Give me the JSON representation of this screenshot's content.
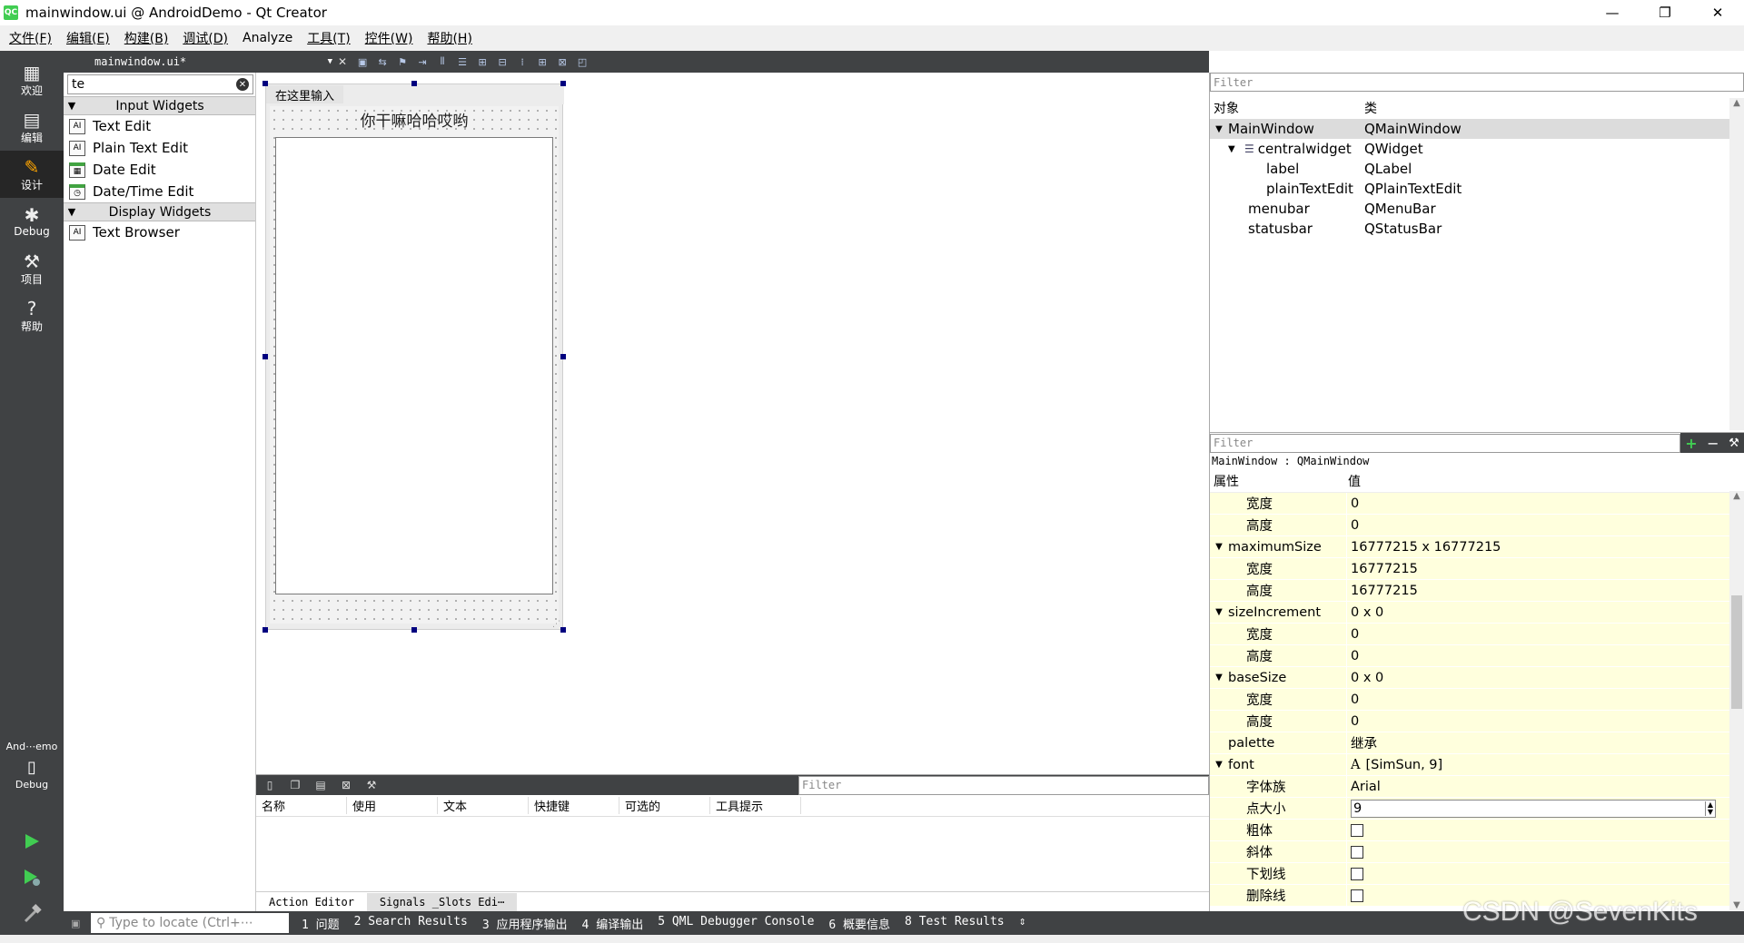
{
  "window": {
    "title": "mainwindow.ui @ AndroidDemo - Qt Creator",
    "app_icon": "QC",
    "minimize": "—",
    "maximize": "❐",
    "close": "✕"
  },
  "menubar": [
    "文件(F)",
    "编辑(E)",
    "构建(B)",
    "调试(D)",
    "Analyze",
    "工具(T)",
    "控件(W)",
    "帮助(H)"
  ],
  "modes": [
    {
      "label": "欢迎",
      "icon": "grid-icon"
    },
    {
      "label": "编辑",
      "icon": "document-icon"
    },
    {
      "label": "设计",
      "icon": "pencil-icon"
    },
    {
      "label": "Debug",
      "icon": "bug-icon"
    },
    {
      "label": "项目",
      "icon": "wrench-icon"
    },
    {
      "label": "帮助",
      "icon": "help-icon"
    }
  ],
  "kit": {
    "name": "And⋯emo",
    "mode": "Debug"
  },
  "editor": {
    "document": "mainwindow.ui*"
  },
  "widgetbox": {
    "filter": "te",
    "categories": [
      {
        "name": "Input Widgets",
        "items": [
          "Text Edit",
          "Plain Text Edit",
          "Date Edit",
          "Date/Time Edit"
        ]
      },
      {
        "name": "Display Widgets",
        "items": [
          "Text Browser"
        ]
      }
    ]
  },
  "form": {
    "menu_placeholder": "在这里输入",
    "label_text": "你干嘛哈哈哎哟"
  },
  "action_editor": {
    "filter_placeholder": "Filter",
    "columns": [
      "名称",
      "使用",
      "文本",
      "快捷键",
      "可选的",
      "工具提示"
    ],
    "tabs": [
      "Action Editor",
      "Signals _Slots Edi⋯"
    ]
  },
  "object_inspector": {
    "filter_placeholder": "Filter",
    "col_object": "对象",
    "col_class": "类",
    "rows": [
      {
        "name": "MainWindow",
        "cls": "QMainWindow"
      },
      {
        "name": "centralwidget",
        "cls": "QWidget"
      },
      {
        "name": "label",
        "cls": "QLabel"
      },
      {
        "name": "plainTextEdit",
        "cls": "QPlainTextEdit"
      },
      {
        "name": "menubar",
        "cls": "QMenuBar"
      },
      {
        "name": "statusbar",
        "cls": "QStatusBar"
      }
    ]
  },
  "property_editor": {
    "filter_placeholder": "Filter",
    "class_line": "MainWindow : QMainWindow",
    "col_prop": "属性",
    "col_value": "值",
    "rows": [
      {
        "name": "宽度",
        "value": "0"
      },
      {
        "name": "高度",
        "value": "0"
      },
      {
        "name": "maximumSize",
        "value": "16777215 x 16777215"
      },
      {
        "name": "宽度",
        "value": "16777215"
      },
      {
        "name": "高度",
        "value": "16777215"
      },
      {
        "name": "sizeIncrement",
        "value": "0 x 0"
      },
      {
        "name": "宽度",
        "value": "0"
      },
      {
        "name": "高度",
        "value": "0"
      },
      {
        "name": "baseSize",
        "value": "0 x 0"
      },
      {
        "name": "宽度",
        "value": "0"
      },
      {
        "name": "高度",
        "value": "0"
      },
      {
        "name": "palette",
        "value": "继承"
      },
      {
        "name": "font",
        "value": "[SimSun, 9]"
      },
      {
        "name": "字体族",
        "value": "Arial"
      },
      {
        "name": "点大小",
        "value": "9"
      },
      {
        "name": "粗体",
        "value": ""
      },
      {
        "name": "斜体",
        "value": ""
      },
      {
        "name": "下划线",
        "value": ""
      },
      {
        "name": "删除线",
        "value": ""
      }
    ]
  },
  "statusbar": {
    "locate_placeholder": "Type to locate (Ctrl+⋯",
    "tabs": [
      "1 问题",
      "2 Search Results",
      "3 应用程序输出",
      "4 编译输出",
      "5 QML Debugger Console",
      "6 概要信息",
      "8 Test Results"
    ]
  },
  "watermark": "CSDN @SevenKits",
  "colors": {
    "sidebar": "#404244",
    "selected_mode": "#262626",
    "property_bg": "#ffffdd",
    "run_green": "#41cd52"
  }
}
